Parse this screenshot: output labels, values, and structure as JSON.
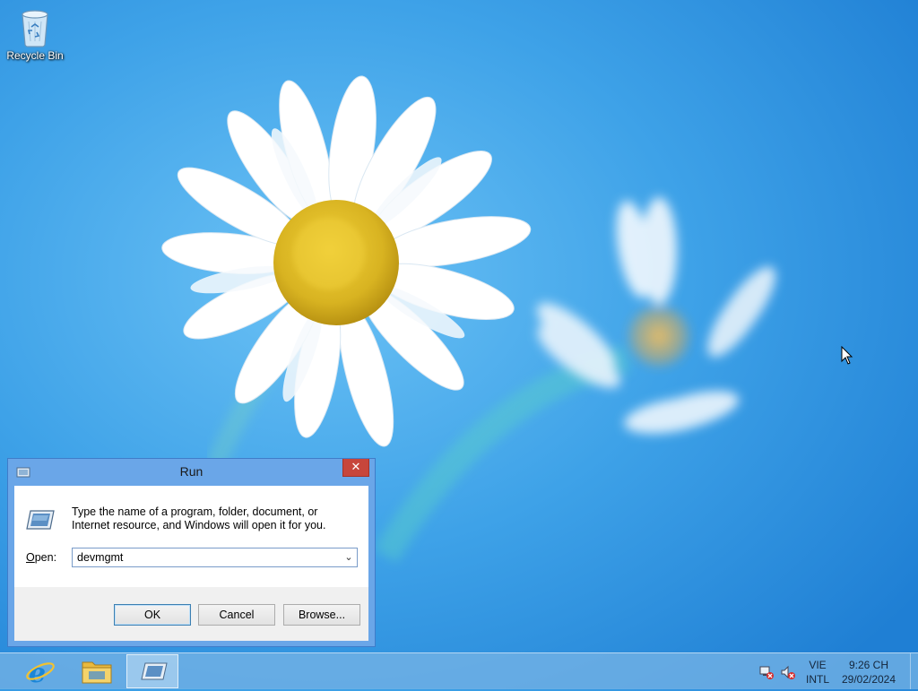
{
  "desktop": {
    "icons": [
      {
        "label": "Recycle Bin",
        "icon": "recycle-bin-icon"
      }
    ]
  },
  "run_dialog": {
    "title": "Run",
    "close_label": "✕",
    "description": "Type the name of a program, folder, document, or Internet resource, and Windows will open it for you.",
    "open_label_accel": "O",
    "open_label_rest": "pen:",
    "open_value": "devmgmt",
    "ok_label": "OK",
    "cancel_label": "Cancel",
    "browse_label": "Browse..."
  },
  "taskbar": {
    "pinned": [
      {
        "name": "Internet Explorer",
        "icon": "ie-icon"
      },
      {
        "name": "File Explorer",
        "icon": "folder-icon"
      },
      {
        "name": "Run",
        "icon": "run-icon",
        "active": true
      }
    ],
    "tray": {
      "network_icon": "network-disconnected-icon",
      "volume_icon": "volume-muted-icon",
      "language_line1": "VIE",
      "language_line2": "INTL",
      "time": "9:26 CH",
      "date": "29/02/2024"
    }
  },
  "colors": {
    "wallpaper_blue": "#3a9fe6",
    "dialog_frame": "#6aa6e8",
    "close_red": "#c7463b",
    "taskbar": "#78b4e6"
  }
}
